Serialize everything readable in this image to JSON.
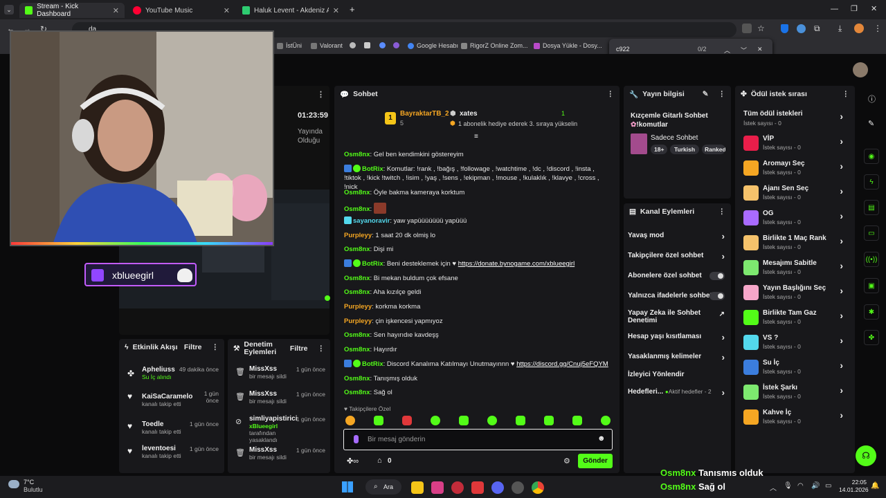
{
  "browser": {
    "tabs": [
      {
        "title": "Stream - Kick Dashboard",
        "active": true
      },
      {
        "title": "YouTube Music",
        "active": false
      },
      {
        "title": "Haluk Levent - Akdeniz Akşamı",
        "active": false
      }
    ],
    "address_partial": "da",
    "bookmarks": [
      "İstÜni",
      "Valorant",
      "Google Hesabı",
      "RigorZ Online Zom...",
      "Dosya Yükle - Dosy..."
    ],
    "find": {
      "query": "c922",
      "count": "0/2"
    }
  },
  "stream": {
    "duration": "01:23:59",
    "status_line1": "Yayında",
    "status_line2": "Olduğu",
    "overlay_name": "xblueegirl"
  },
  "activity": {
    "title": "Etkinlik Akışı",
    "filter": "Filtre",
    "items": [
      {
        "name": "Apheliuss",
        "detail": "Su İç alındı",
        "time": "49 dakika önce"
      },
      {
        "name": "KaiSaCaramelo",
        "detail": "kanalı takip etti",
        "time": "1 gün önce"
      },
      {
        "name": "Toedle",
        "detail": "kanalı takip etti",
        "time": "1 gün önce"
      },
      {
        "name": "leventoesi",
        "detail": "kanalı takip etti",
        "time": "1 gün önce"
      }
    ]
  },
  "moderation": {
    "title": "Denetim Eylemleri",
    "filter": "Filtre",
    "items": [
      {
        "name": "MissXss",
        "detail": "bir mesajı sildi",
        "time": "1 gün önce"
      },
      {
        "name": "MissXss",
        "detail": "bir mesajı sildi",
        "time": "1 gün önce"
      },
      {
        "name": "simliyapistirici",
        "detail_user": "xBlueegirl",
        "detail": "tarafından yasaklandı",
        "time": "1 gün önce"
      },
      {
        "name": "MissXss",
        "detail": "bir mesajı sildi",
        "time": "1 gün önce"
      }
    ]
  },
  "chat": {
    "title": "Sohbet",
    "pinned": {
      "rank": "1",
      "user": "BayraktarTB_2",
      "count": "5",
      "gifter": "xates",
      "gift_count": "1",
      "gift_text": "1 abonelik hediye ederek 3. sıraya yükselin"
    },
    "messages": [
      {
        "user": "Osm8nx",
        "text": "Gel ben kendimkini göstereyim"
      },
      {
        "user": "BotRix",
        "text": "Komutlar: !rank , !bağış , !followage , !watchtime , !dc , !discord , !insta , !tiktok , !kick !twitch , !isim , !yaş , !sens , !ekipman , !mouse , !kulaklık , !klavye , !cross , !nick"
      },
      {
        "user": "Osm8nx",
        "text": "Öyle bakma kameraya korktum"
      },
      {
        "user": "Osm8nx",
        "text": ""
      },
      {
        "user": "sayanoravir",
        "text": "yaw yapüüüüüüü yapüüü"
      },
      {
        "user": "Purpleyy",
        "text": "1 saat 20 dk olmiş lo"
      },
      {
        "user": "Osm8nx",
        "text": "Dişi mi"
      },
      {
        "user": "BotRix",
        "text": "Beni desteklemek için ♥",
        "link": "https://donate.bynogame.com/xblueegirl"
      },
      {
        "user": "Osm8nx",
        "text": "Bi mekan buldum çok efsane"
      },
      {
        "user": "Osm8nx",
        "text": "Aha kızılçe geldi"
      },
      {
        "user": "Purpleyy",
        "text": "korkma korkma"
      },
      {
        "user": "Purpleyy",
        "text": "çin işkencesi yapmıyoz"
      },
      {
        "user": "Osm8nx",
        "text": "Sen hayırıdıe kavdeşş"
      },
      {
        "user": "Osm8nx",
        "text": "Hayırdır"
      },
      {
        "user": "BotRix",
        "text": "Discord Kanalıma Katılmayı Unutmayınnn ♥",
        "link": "https://discord.gg/Cnuj5eFQYM"
      },
      {
        "user": "Osm8nx",
        "text": "Tanışmış olduk"
      },
      {
        "user": "Osm8nx",
        "text": "Sağ ol"
      }
    ],
    "followers_only": "Takipçilere Özel",
    "input_placeholder": "Bir mesaj gönderin",
    "points": "0",
    "send_label": "Gönder"
  },
  "stream_info": {
    "title": "Yayın bilgisi",
    "stream_title": "Kızçemle Gitarlı Sohbet",
    "command": "!komutlar",
    "category": "Sadece Sohbet",
    "tags": [
      "18+",
      "Turkish",
      "Ranked"
    ]
  },
  "channel_actions": {
    "title": "Kanal Eylemleri",
    "rows": [
      {
        "label": "Yavaş mod",
        "type": "chevron"
      },
      {
        "label": "Takipçilere özel sohbet",
        "type": "chevron"
      },
      {
        "label": "Abonelere özel sohbet",
        "type": "toggle"
      },
      {
        "label": "Yalnızca ifadelerle sohbet",
        "type": "toggle"
      },
      {
        "label": "Yapay Zeka ile Sohbet Denetimi",
        "type": "external"
      },
      {
        "label": "Hesap yaşı kısıtlaması",
        "type": "chevron"
      },
      {
        "label": "Yasaklanmış kelimeler",
        "type": "chevron"
      },
      {
        "label": "İzleyici Yönlendir",
        "type": "none"
      },
      {
        "label": "Hedefleri...",
        "type": "chevron",
        "extra": "Aktif hedefler - 2"
      }
    ]
  },
  "rewards": {
    "title": "Ödül istek sırası",
    "all_label": "Tüm ödül istekleri",
    "all_count": "İstek sayısı - 0",
    "items": [
      {
        "name": "VİP",
        "count": "İstek sayısı - 0",
        "color": "#e91e4a"
      },
      {
        "name": "Aromayı Seç",
        "count": "İstek sayısı - 0",
        "color": "#f5a623"
      },
      {
        "name": "Ajanı Sen Seç",
        "count": "İstek sayısı - 0",
        "color": "#f5c26b"
      },
      {
        "name": "OG",
        "count": "İstek sayısı - 0",
        "color": "#a96bff"
      },
      {
        "name": "Birlikte 1 Maç Rank",
        "count": "İstek sayısı - 0",
        "color": "#f5c26b"
      },
      {
        "name": "Mesajımı Sabitle",
        "count": "İstek sayısı - 0",
        "color": "#7de86f"
      },
      {
        "name": "Yayın Başlığını Seç",
        "count": "İstek sayısı - 0",
        "color": "#f6a6c9"
      },
      {
        "name": "Birlikte Tam Gaz",
        "count": "İstek sayısı - 0",
        "color": "#53fc18"
      },
      {
        "name": "VS ?",
        "count": "İstek sayısı - 0",
        "color": "#53d8ec"
      },
      {
        "name": "Su İç",
        "count": "İstek sayısı - 0",
        "color": "#3b7ddd"
      },
      {
        "name": "İstek Şarkı",
        "count": "İstek sayısı - 0",
        "color": "#7de86f"
      },
      {
        "name": "Kahve İç",
        "count": "İstek sayısı - 0",
        "color": "#f5a623"
      }
    ]
  },
  "overlay_chat": [
    {
      "user": "Osm8nx",
      "text": "Tanışmış olduk"
    },
    {
      "user": "Osm8nx",
      "text": "Sağ ol"
    }
  ],
  "taskbar": {
    "weather_temp": "7°C",
    "weather_desc": "Bulutlu",
    "search_label": "Ara",
    "time": "22:05",
    "date": "14.01.2026"
  }
}
